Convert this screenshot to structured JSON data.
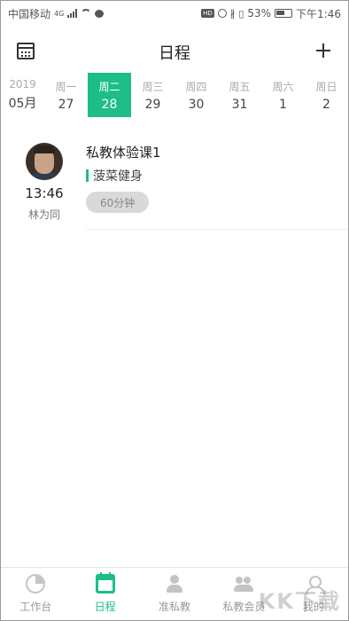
{
  "status_bar": {
    "carrier": "中国移动",
    "network": "4G",
    "battery": "53%",
    "time": "下午1:46"
  },
  "header": {
    "title": "日程"
  },
  "week": {
    "year": "2019",
    "month": "05月",
    "days": [
      {
        "weekday": "周一",
        "date": "27"
      },
      {
        "weekday": "周二",
        "date": "28"
      },
      {
        "weekday": "周三",
        "date": "29"
      },
      {
        "weekday": "周四",
        "date": "30"
      },
      {
        "weekday": "周五",
        "date": "31"
      },
      {
        "weekday": "周六",
        "date": "1"
      },
      {
        "weekday": "周日",
        "date": "2"
      }
    ],
    "selected_index": 1
  },
  "schedule": {
    "time": "13:46",
    "coach": "林为同",
    "class_name": "私教体验课1",
    "gym": "菠菜健身",
    "duration": "60分钟"
  },
  "tabs": [
    {
      "label": "工作台",
      "icon": "dashboard-icon"
    },
    {
      "label": "日程",
      "icon": "calendar-icon"
    },
    {
      "label": "准私教",
      "icon": "prospect-icon"
    },
    {
      "label": "私教会员",
      "icon": "members-icon"
    },
    {
      "label": "我的",
      "icon": "profile-icon"
    }
  ],
  "active_tab": 1,
  "colors": {
    "accent": "#1dbe86"
  },
  "watermark": "KK下载"
}
